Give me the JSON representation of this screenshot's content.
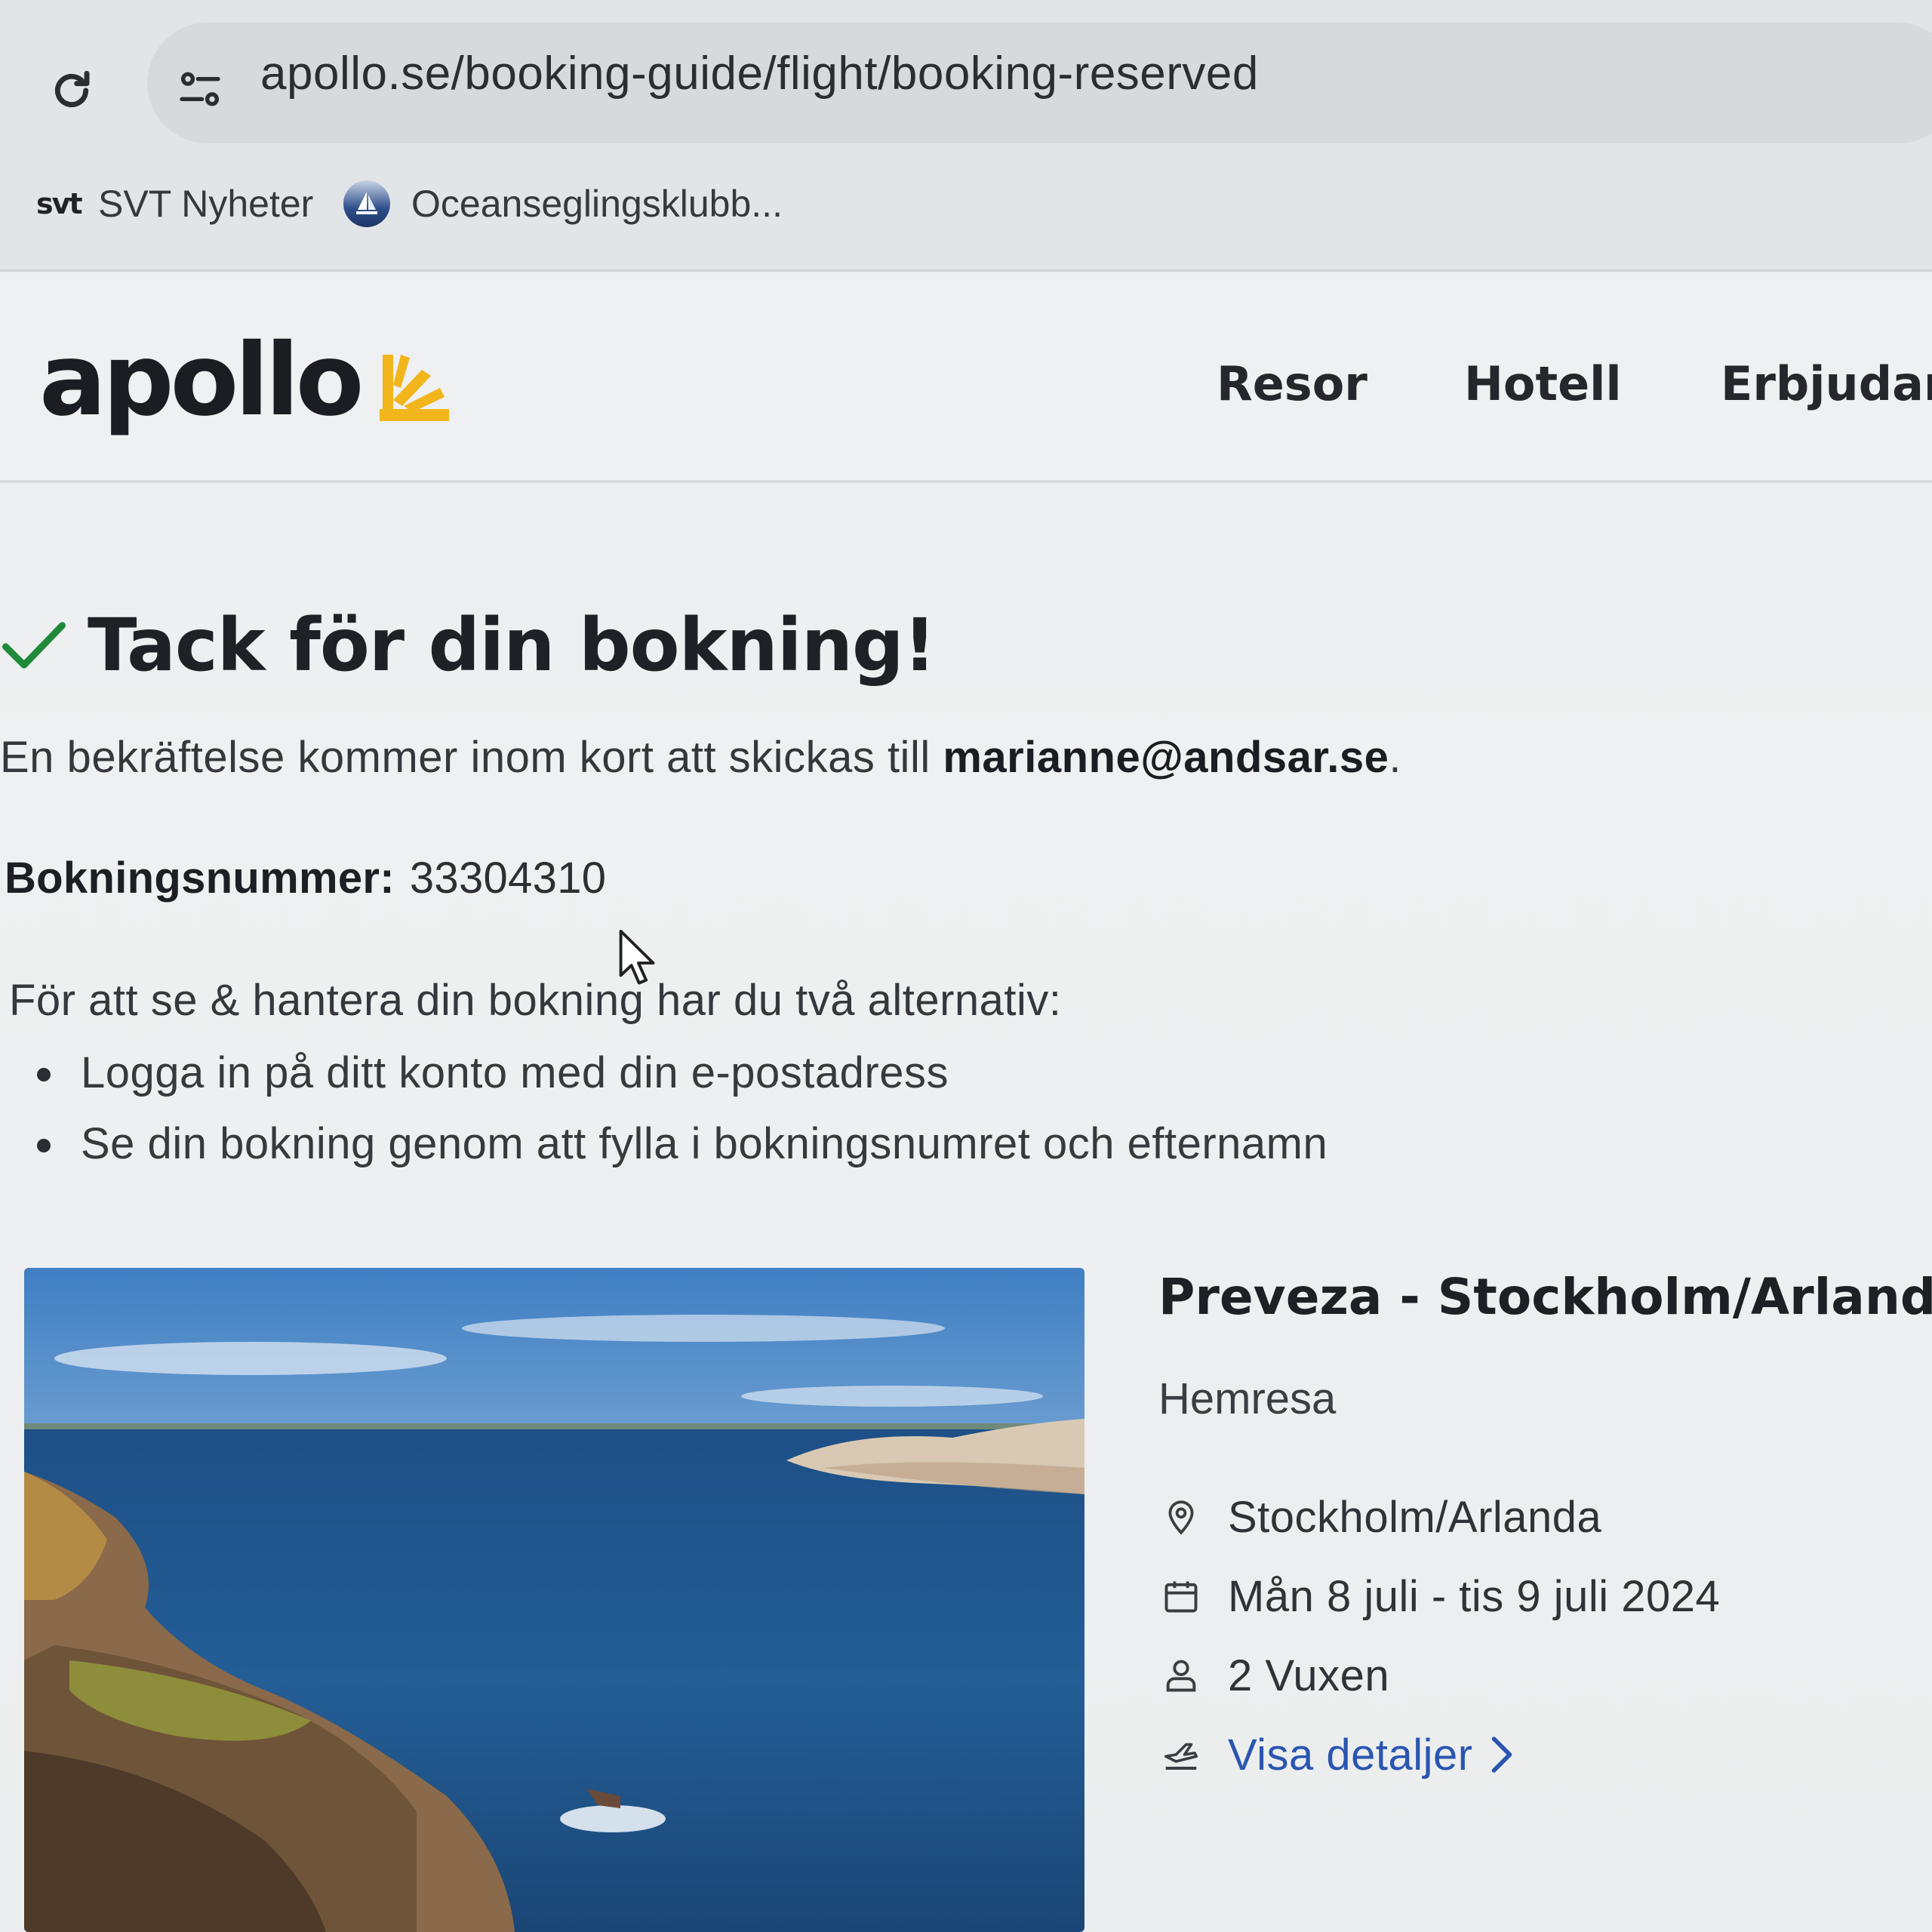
{
  "browser": {
    "url": "apollo.se/booking-guide/flight/booking-reserved",
    "bookmarks": [
      {
        "label": "SVT Nyheter",
        "icon": "svt-logo-icon",
        "icon_text": "svt"
      },
      {
        "label": "Oceanseglingsklubb...",
        "icon": "sailing-club-logo-icon"
      }
    ]
  },
  "site": {
    "logo_text": "apollo",
    "accent_color": "#f2b51c",
    "nav": [
      "Resor",
      "Hotell",
      "Erbjudar"
    ]
  },
  "confirmation": {
    "title": "Tack för din bokning!",
    "message_prefix": "En bekräftelse kommer inom kort att skickas till ",
    "email": "marianne@andsar.se",
    "message_suffix": ".",
    "booking_label": "Bokningsnummer:",
    "booking_number": "33304310",
    "manage_intro": "För att se & hantera din bokning har du två alternativ:",
    "options": [
      "Logga in på ditt konto med din e-postadress",
      "Se din bokning genom att fylla i bokningsnumret och efternamn"
    ]
  },
  "trip": {
    "title": "Preveza - Stockholm/Arland",
    "direction": "Hemresa",
    "destination": "Stockholm/Arlanda",
    "dates": "Mån 8 juli - tis 9 juli 2024",
    "passengers": "2 Vuxen",
    "details_link": "Visa detaljer",
    "link_color": "#2a55b0"
  }
}
